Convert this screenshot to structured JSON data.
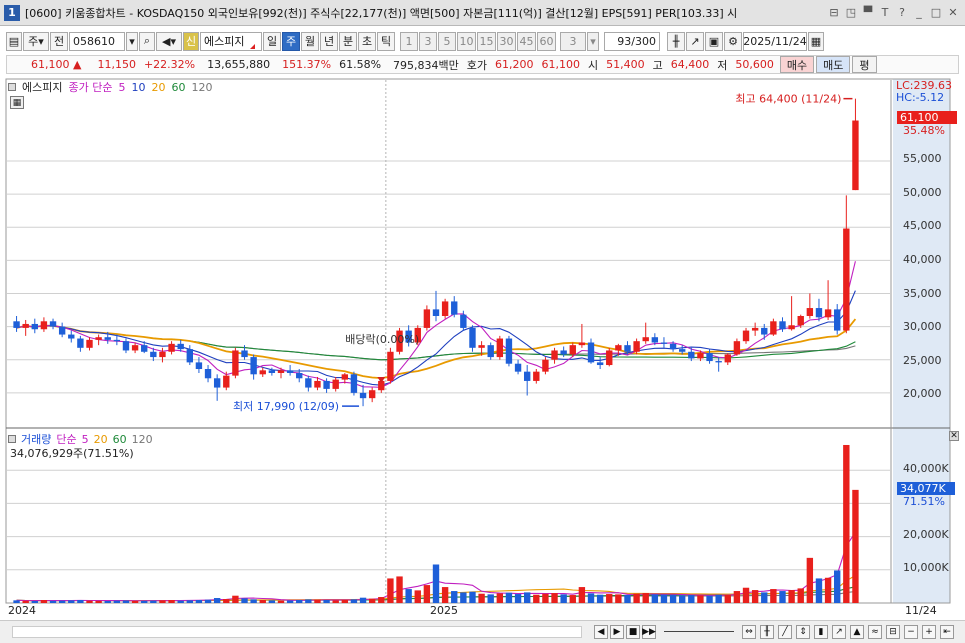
{
  "window": {
    "number": "1",
    "title": "[0600] 키움종합차트 - KOSDAQ150 외국인보유[992(천)] 주식수[22,177(천)] 액면[500] 자본금[111(억)] 결산[12월] EPS[591] PER[103.33] 시",
    "buttons": [
      "⊟",
      "◳",
      "▀",
      "T",
      "?",
      "_",
      "□",
      "✕"
    ]
  },
  "toolbar": {
    "period_select": "주",
    "prev_label": "전",
    "stock_code": "058610",
    "badge": "신",
    "stock_name": "에스피지",
    "tabs": [
      "일",
      "주",
      "월",
      "년",
      "분",
      "초",
      "틱"
    ],
    "active_tab": "주",
    "intervals": [
      "1",
      "3",
      "5",
      "10",
      "15",
      "30",
      "45",
      "60"
    ],
    "count_select": "3",
    "range": "93/300",
    "date": "2025/11/24"
  },
  "quote": {
    "price": "61,100",
    "change": "11,150",
    "change_pct": "+22.32%",
    "volume": "13,655,880",
    "volume_ratio": "151.37%",
    "turnover": "61.58%",
    "amount": "795,834백만",
    "hoga_label": "호가",
    "ask": "61,200",
    "bid": "61,100",
    "open_label": "시",
    "open": "51,400",
    "high_label": "고",
    "high": "64,400",
    "low_label": "저",
    "low": "50,600",
    "buy_label": "매수",
    "sell_label": "매도",
    "eval_label": "평"
  },
  "price_panel": {
    "legend_name": "에스피지",
    "legend_type": "종가 단순",
    "ma": [
      "5",
      "10",
      "20",
      "60",
      "120"
    ],
    "ma_colors": [
      "#c020c0",
      "#1e3fbf",
      "#e89a00",
      "#1f8a3a",
      "#777777"
    ],
    "lc": "LC:239.63",
    "hc": "HC:-5.12",
    "current_tag": "61,100",
    "current_pct": "35.48%",
    "high_annot": "최고 64,400 (11/24)",
    "low_annot": "최저 17,990 (12/09)",
    "dividend_annot": "배당락(0.00%)",
    "y_ticks": [
      "55,000",
      "50,000",
      "45,000",
      "40,000",
      "35,000",
      "30,000",
      "25,000",
      "20,000"
    ]
  },
  "volume_panel": {
    "legend_name": "거래량",
    "legend_type": "단순",
    "ma": [
      "5",
      "20",
      "60",
      "120"
    ],
    "ma_colors": [
      "#c020c0",
      "#e89a00",
      "#1f8a3a",
      "#777777"
    ],
    "current_volume": "34,076,929주(71.51%)",
    "current_tag": "34,077K",
    "current_pct": "71.51%",
    "y_ticks": [
      "40,000K",
      "30,000K",
      "20,000K",
      "10,000K"
    ]
  },
  "x_axis": {
    "labels": [
      "2024",
      "2025"
    ],
    "right_label": "11/24"
  },
  "colors": {
    "up": "#e8201c",
    "down": "#1e5fd8",
    "axis_bg": "#dfe9f5"
  },
  "chart_data": {
    "type": "candlestick",
    "interval": "weekly",
    "ohlc": [
      [
        30800,
        31600,
        29200,
        29800
      ],
      [
        29800,
        31000,
        28600,
        30400
      ],
      [
        30400,
        31200,
        29000,
        29600
      ],
      [
        29600,
        31400,
        29200,
        30800
      ],
      [
        30800,
        31200,
        29600,
        30000
      ],
      [
        30000,
        30600,
        28400,
        28800
      ],
      [
        28800,
        29400,
        27600,
        28200
      ],
      [
        28200,
        28600,
        26200,
        26800
      ],
      [
        26800,
        28400,
        26400,
        28000
      ],
      [
        28000,
        28800,
        27200,
        28400
      ],
      [
        28400,
        29200,
        27400,
        28000
      ],
      [
        28000,
        28800,
        27200,
        27800
      ],
      [
        27800,
        28200,
        26000,
        26400
      ],
      [
        26400,
        27600,
        26000,
        27200
      ],
      [
        27200,
        27800,
        26000,
        26200
      ],
      [
        26200,
        26800,
        24800,
        25400
      ],
      [
        25400,
        26800,
        24600,
        26200
      ],
      [
        26200,
        27800,
        25800,
        27400
      ],
      [
        27400,
        28000,
        26200,
        26600
      ],
      [
        26600,
        27200,
        24200,
        24600
      ],
      [
        24600,
        25400,
        23000,
        23600
      ],
      [
        23600,
        24200,
        21600,
        22200
      ],
      [
        22200,
        22800,
        18800,
        20800
      ],
      [
        20800,
        23200,
        20400,
        22600
      ],
      [
        22600,
        26800,
        22200,
        26400
      ],
      [
        26400,
        27200,
        25000,
        25400
      ],
      [
        25400,
        25800,
        22000,
        22800
      ],
      [
        22800,
        23800,
        22400,
        23400
      ],
      [
        23400,
        23800,
        22600,
        23000
      ],
      [
        23000,
        23800,
        22200,
        23400
      ],
      [
        23400,
        24200,
        22600,
        23000
      ],
      [
        23000,
        23600,
        21600,
        22200
      ],
      [
        22200,
        22600,
        20200,
        20800
      ],
      [
        20800,
        22400,
        20400,
        21800
      ],
      [
        21800,
        22200,
        20000,
        20600
      ],
      [
        20600,
        22400,
        20200,
        22000
      ],
      [
        22000,
        23000,
        21400,
        22800
      ],
      [
        22800,
        23200,
        19600,
        20000
      ],
      [
        20000,
        21200,
        17990,
        19200
      ],
      [
        19200,
        20800,
        18600,
        20400
      ],
      [
        20400,
        22200,
        20000,
        21800
      ],
      [
        21800,
        26800,
        21400,
        26200
      ],
      [
        26200,
        29800,
        25800,
        29400
      ],
      [
        29400,
        30200,
        27000,
        27600
      ],
      [
        27600,
        30200,
        27200,
        29800
      ],
      [
        29800,
        33200,
        29400,
        32600
      ],
      [
        32600,
        35400,
        30800,
        31600
      ],
      [
        31600,
        34200,
        31200,
        33800
      ],
      [
        33800,
        34600,
        31400,
        31800
      ],
      [
        31800,
        32400,
        29400,
        29800
      ],
      [
        29800,
        30200,
        26200,
        26800
      ],
      [
        26800,
        27800,
        25600,
        27200
      ],
      [
        27200,
        27600,
        25000,
        25400
      ],
      [
        25400,
        28600,
        25000,
        28200
      ],
      [
        28200,
        28600,
        24000,
        24400
      ],
      [
        24400,
        25000,
        22800,
        23200
      ],
      [
        23200,
        24200,
        19600,
        21800
      ],
      [
        21800,
        23600,
        21400,
        23200
      ],
      [
        23200,
        25400,
        22800,
        25000
      ],
      [
        25000,
        26800,
        24400,
        26400
      ],
      [
        26400,
        27000,
        25400,
        25800
      ],
      [
        25800,
        27600,
        25400,
        27200
      ],
      [
        27200,
        30400,
        26800,
        27600
      ],
      [
        27600,
        28200,
        24400,
        24600
      ],
      [
        24600,
        25400,
        23600,
        24200
      ],
      [
        24200,
        26800,
        24000,
        26400
      ],
      [
        26400,
        27400,
        25600,
        27200
      ],
      [
        27200,
        27800,
        25800,
        26200
      ],
      [
        26200,
        28200,
        25800,
        27800
      ],
      [
        27800,
        30600,
        27400,
        28400
      ],
      [
        28400,
        29000,
        27200,
        27600
      ],
      [
        27600,
        28400,
        26800,
        27400
      ],
      [
        27400,
        27800,
        26200,
        26600
      ],
      [
        26600,
        27200,
        25800,
        26200
      ],
      [
        26200,
        26800,
        24800,
        25200
      ],
      [
        25200,
        26400,
        24800,
        26000
      ],
      [
        26000,
        26600,
        24400,
        24800
      ],
      [
        24800,
        25400,
        23200,
        24600
      ],
      [
        24600,
        26000,
        24200,
        25800
      ],
      [
        25800,
        28200,
        25600,
        27800
      ],
      [
        27800,
        29800,
        27400,
        29400
      ],
      [
        29400,
        30600,
        28600,
        29800
      ],
      [
        29800,
        30400,
        28000,
        28800
      ],
      [
        28800,
        31200,
        28600,
        30800
      ],
      [
        30800,
        31400,
        29200,
        29600
      ],
      [
        29600,
        34600,
        29400,
        30200
      ],
      [
        30200,
        31800,
        29800,
        31600
      ],
      [
        31600,
        35000,
        31200,
        32800
      ],
      [
        32800,
        34200,
        30800,
        31400
      ],
      [
        31400,
        37000,
        31000,
        32600
      ],
      [
        32600,
        33400,
        28800,
        29400
      ],
      [
        29400,
        49800,
        29000,
        44800
      ],
      [
        50600,
        64400,
        50600,
        61100
      ]
    ],
    "volume_k": [
      800,
      700,
      600,
      900,
      650,
      700,
      800,
      900,
      700,
      650,
      600,
      700,
      750,
      600,
      650,
      700,
      800,
      900,
      700,
      800,
      900,
      1000,
      1500,
      1200,
      2200,
      1400,
      1100,
      900,
      800,
      700,
      750,
      900,
      1100,
      1000,
      900,
      800,
      900,
      1100,
      1600,
      1300,
      1800,
      7400,
      8000,
      4200,
      3800,
      5400,
      11600,
      4800,
      3600,
      3200,
      3400,
      2800,
      2600,
      2900,
      3100,
      2700,
      3200,
      2500,
      2800,
      3000,
      2600,
      2400,
      4800,
      2900,
      2500,
      2700,
      2600,
      2400,
      2800,
      3000,
      2600,
      2500,
      2400,
      2300,
      2400,
      2300,
      2200,
      2500,
      2400,
      3600,
      4600,
      3900,
      3200,
      4200,
      3600,
      3900,
      4400,
      13600,
      7400,
      7600,
      9800,
      47600,
      34077
    ]
  }
}
